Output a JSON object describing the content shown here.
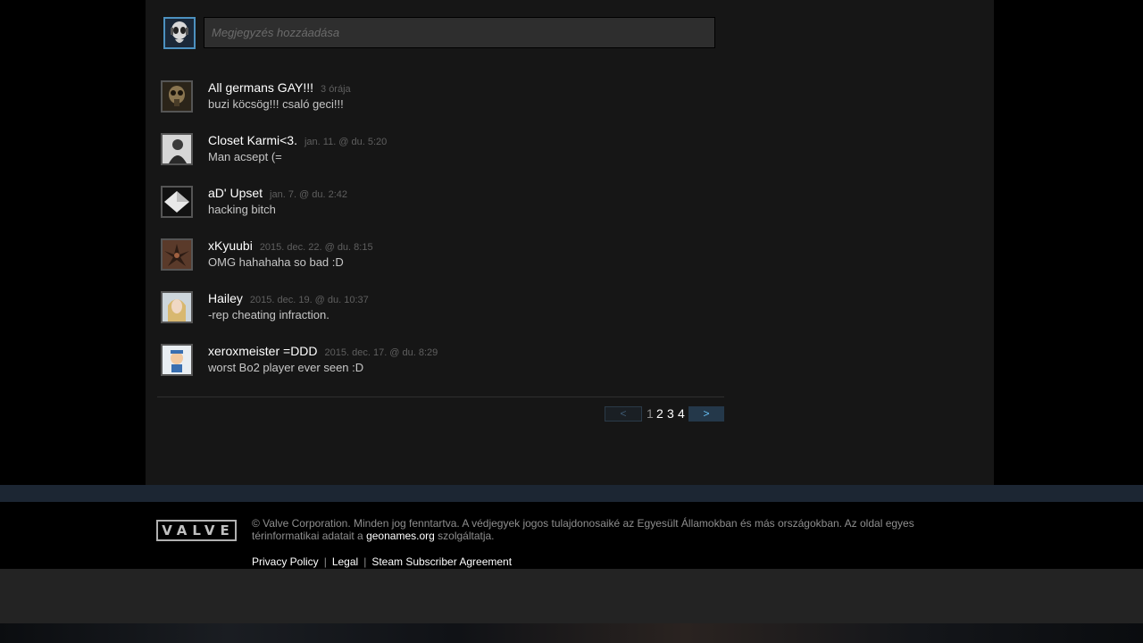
{
  "composer": {
    "placeholder": "Megjegyzés hozzáadása"
  },
  "comments": [
    {
      "author": "All germans GAY!!!",
      "time": "3 órája",
      "text": "buzi köcsög!!! csaló geci!!!"
    },
    {
      "author": "Closet Karmi<3.",
      "time": "jan. 11. @ du. 5:20",
      "text": "Man acsept (="
    },
    {
      "author": "aD' Upset",
      "time": "jan. 7. @ du. 2:42",
      "text": "hacking bitch"
    },
    {
      "author": "xKyuubi",
      "time": "2015. dec. 22. @ du. 8:15",
      "text": "OMG hahahaha so bad :D"
    },
    {
      "author": "Hailey",
      "time": "2015. dec. 19. @ du. 10:37",
      "text": "-rep cheating infraction."
    },
    {
      "author": "xeroxmeister =DDD",
      "time": "2015. dec. 17. @ du. 8:29",
      "text": "worst Bo2 player ever seen :D"
    }
  ],
  "pagination": {
    "prev": "<",
    "next": ">",
    "pages": [
      "1",
      "2",
      "3",
      "4"
    ],
    "current": "1"
  },
  "footer": {
    "logo": "VALVE",
    "copyright_line1": "© Valve Corporation. Minden jog fenntartva. A védjegyek jogos tulajdonosaiké az Egyesült Államokban és más országokban. Az oldal egyes",
    "copyright_line2_pre": "térinformatikai adatait a",
    "geonames": "geonames.org",
    "copyright_line2_post": "szolgáltatja.",
    "links": {
      "privacy": "Privacy Policy",
      "legal": "Legal",
      "ssa": "Steam Subscriber Agreement",
      "separator": "|"
    }
  },
  "colors": {
    "accent_link": "#67c1f5",
    "avatar_border_self": "#4c91c0",
    "panel_bg": "#161616"
  }
}
